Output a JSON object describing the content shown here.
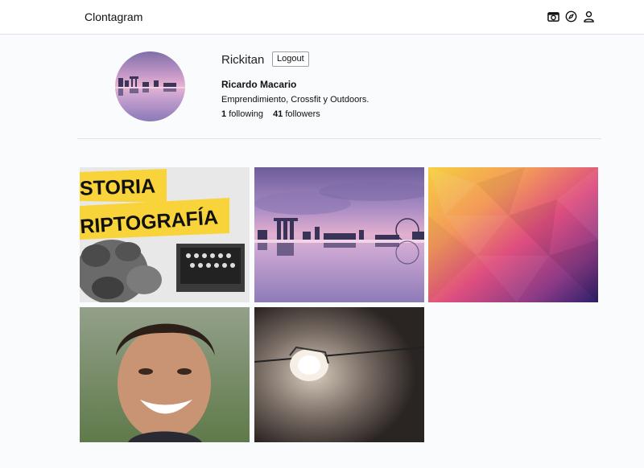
{
  "app": {
    "brand": "Clontagram"
  },
  "nav": {
    "icons": [
      "camera-icon",
      "compass-icon",
      "user-icon"
    ]
  },
  "profile": {
    "username": "Rickitan",
    "logout_label": "Logout",
    "full_name": "Ricardo Macario",
    "bio": "Emprendimiento, Crossfit y Outdoors.",
    "following_count": "1",
    "following_label": "following",
    "followers_count": "41",
    "followers_label": "followers"
  },
  "posts": [
    {
      "name": "post-historia-criptografia",
      "text_line1": "STORIA",
      "text_line2": "RIPTOGRAFÍA"
    },
    {
      "name": "post-city-skyline"
    },
    {
      "name": "post-low-poly-gradient"
    },
    {
      "name": "post-portrait-smiling-man"
    },
    {
      "name": "post-spotlight-lamp"
    }
  ],
  "colors": {
    "topbar_bg": "#ffffff",
    "page_bg": "#fafbfc",
    "banner_yellow": "#f9d33a"
  }
}
